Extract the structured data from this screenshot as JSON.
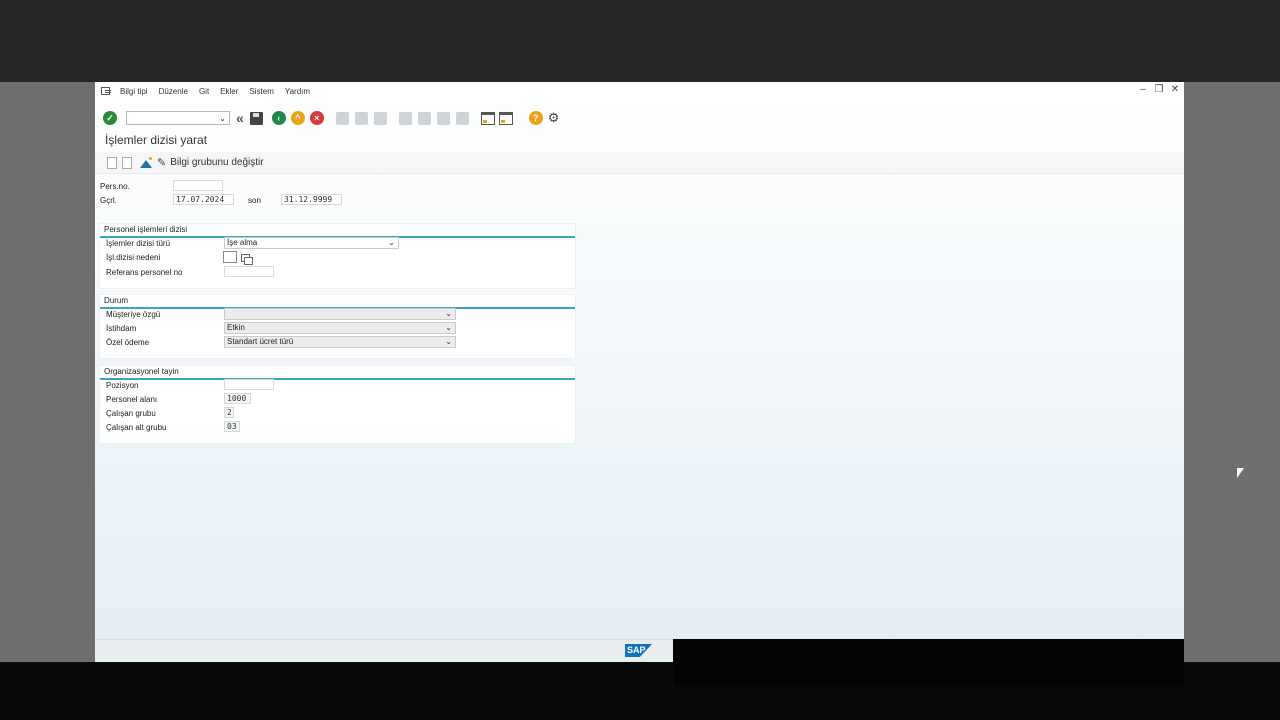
{
  "menubar": {
    "items": [
      "Bilgi tipi",
      "Düzenle",
      "Git",
      "Ekler",
      "Sistem",
      "Yardım"
    ]
  },
  "window": {
    "minimize": "–",
    "restore": "❐",
    "close": "✕"
  },
  "toolbar": {
    "command_value": "",
    "back_glyph": "«"
  },
  "page": {
    "title": "İşlemler dizisi yarat"
  },
  "app_toolbar": {
    "change_infogroup_label": "Bilgi grubunu değiştir"
  },
  "header_fields": {
    "pers_no_label": "Pers.no.",
    "pers_no_value": "",
    "start_label": "Gçrl.",
    "start_value": "17.07.2024",
    "end_label": "son",
    "end_value": "31.12.9999"
  },
  "group_actions": {
    "title": "Personel işlemleri dizisi",
    "action_type_label": "İşlemler dizisi türü",
    "action_type_value": "İşe alma",
    "reason_label": "İşl.dizisi nedeni",
    "reason_value": "",
    "ref_pers_label": "Referans personel no",
    "ref_pers_value": ""
  },
  "group_status": {
    "title": "Durum",
    "customer_label": "Müşteriye özgü",
    "customer_value": "",
    "employment_label": "İstihdam",
    "employment_value": "Etkin",
    "special_pay_label": "Özel ödeme",
    "special_pay_value": "Standart ücret türü"
  },
  "group_org": {
    "title": "Organizasyonel tayin",
    "position_label": "Pozisyon",
    "position_value": "",
    "pers_area_label": "Personel alanı",
    "pers_area_value": "1000",
    "emp_group_label": "Çalışan grubu",
    "emp_group_value": "2",
    "emp_subgroup_label": "Çalışan alt grubu",
    "emp_subgroup_value": "03"
  },
  "footer": {
    "logo_text": "SAP"
  },
  "colors": {
    "accent_line": "#3aa4c2",
    "ok_green": "#2a8a3a",
    "cancel_red": "#d23c3c",
    "exit_yellow": "#e8a41a"
  }
}
